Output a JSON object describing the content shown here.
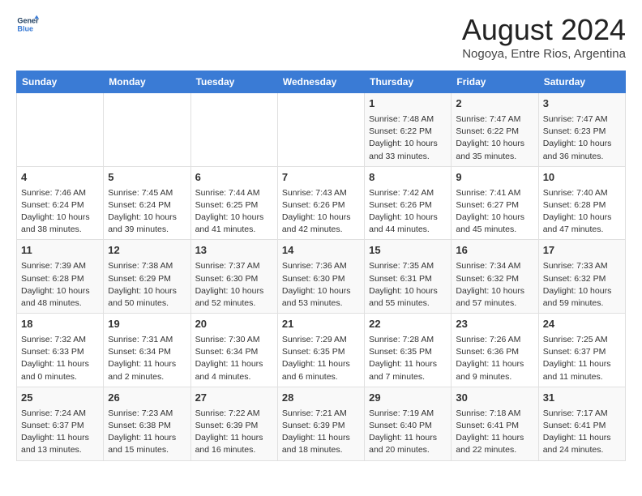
{
  "header": {
    "logo_line1": "General",
    "logo_line2": "Blue",
    "title": "August 2024",
    "subtitle": "Nogoya, Entre Rios, Argentina"
  },
  "columns": [
    "Sunday",
    "Monday",
    "Tuesday",
    "Wednesday",
    "Thursday",
    "Friday",
    "Saturday"
  ],
  "weeks": [
    [
      {
        "day": "",
        "info": ""
      },
      {
        "day": "",
        "info": ""
      },
      {
        "day": "",
        "info": ""
      },
      {
        "day": "",
        "info": ""
      },
      {
        "day": "1",
        "info": "Sunrise: 7:48 AM\nSunset: 6:22 PM\nDaylight: 10 hours\nand 33 minutes."
      },
      {
        "day": "2",
        "info": "Sunrise: 7:47 AM\nSunset: 6:22 PM\nDaylight: 10 hours\nand 35 minutes."
      },
      {
        "day": "3",
        "info": "Sunrise: 7:47 AM\nSunset: 6:23 PM\nDaylight: 10 hours\nand 36 minutes."
      }
    ],
    [
      {
        "day": "4",
        "info": "Sunrise: 7:46 AM\nSunset: 6:24 PM\nDaylight: 10 hours\nand 38 minutes."
      },
      {
        "day": "5",
        "info": "Sunrise: 7:45 AM\nSunset: 6:24 PM\nDaylight: 10 hours\nand 39 minutes."
      },
      {
        "day": "6",
        "info": "Sunrise: 7:44 AM\nSunset: 6:25 PM\nDaylight: 10 hours\nand 41 minutes."
      },
      {
        "day": "7",
        "info": "Sunrise: 7:43 AM\nSunset: 6:26 PM\nDaylight: 10 hours\nand 42 minutes."
      },
      {
        "day": "8",
        "info": "Sunrise: 7:42 AM\nSunset: 6:26 PM\nDaylight: 10 hours\nand 44 minutes."
      },
      {
        "day": "9",
        "info": "Sunrise: 7:41 AM\nSunset: 6:27 PM\nDaylight: 10 hours\nand 45 minutes."
      },
      {
        "day": "10",
        "info": "Sunrise: 7:40 AM\nSunset: 6:28 PM\nDaylight: 10 hours\nand 47 minutes."
      }
    ],
    [
      {
        "day": "11",
        "info": "Sunrise: 7:39 AM\nSunset: 6:28 PM\nDaylight: 10 hours\nand 48 minutes."
      },
      {
        "day": "12",
        "info": "Sunrise: 7:38 AM\nSunset: 6:29 PM\nDaylight: 10 hours\nand 50 minutes."
      },
      {
        "day": "13",
        "info": "Sunrise: 7:37 AM\nSunset: 6:30 PM\nDaylight: 10 hours\nand 52 minutes."
      },
      {
        "day": "14",
        "info": "Sunrise: 7:36 AM\nSunset: 6:30 PM\nDaylight: 10 hours\nand 53 minutes."
      },
      {
        "day": "15",
        "info": "Sunrise: 7:35 AM\nSunset: 6:31 PM\nDaylight: 10 hours\nand 55 minutes."
      },
      {
        "day": "16",
        "info": "Sunrise: 7:34 AM\nSunset: 6:32 PM\nDaylight: 10 hours\nand 57 minutes."
      },
      {
        "day": "17",
        "info": "Sunrise: 7:33 AM\nSunset: 6:32 PM\nDaylight: 10 hours\nand 59 minutes."
      }
    ],
    [
      {
        "day": "18",
        "info": "Sunrise: 7:32 AM\nSunset: 6:33 PM\nDaylight: 11 hours\nand 0 minutes."
      },
      {
        "day": "19",
        "info": "Sunrise: 7:31 AM\nSunset: 6:34 PM\nDaylight: 11 hours\nand 2 minutes."
      },
      {
        "day": "20",
        "info": "Sunrise: 7:30 AM\nSunset: 6:34 PM\nDaylight: 11 hours\nand 4 minutes."
      },
      {
        "day": "21",
        "info": "Sunrise: 7:29 AM\nSunset: 6:35 PM\nDaylight: 11 hours\nand 6 minutes."
      },
      {
        "day": "22",
        "info": "Sunrise: 7:28 AM\nSunset: 6:35 PM\nDaylight: 11 hours\nand 7 minutes."
      },
      {
        "day": "23",
        "info": "Sunrise: 7:26 AM\nSunset: 6:36 PM\nDaylight: 11 hours\nand 9 minutes."
      },
      {
        "day": "24",
        "info": "Sunrise: 7:25 AM\nSunset: 6:37 PM\nDaylight: 11 hours\nand 11 minutes."
      }
    ],
    [
      {
        "day": "25",
        "info": "Sunrise: 7:24 AM\nSunset: 6:37 PM\nDaylight: 11 hours\nand 13 minutes."
      },
      {
        "day": "26",
        "info": "Sunrise: 7:23 AM\nSunset: 6:38 PM\nDaylight: 11 hours\nand 15 minutes."
      },
      {
        "day": "27",
        "info": "Sunrise: 7:22 AM\nSunset: 6:39 PM\nDaylight: 11 hours\nand 16 minutes."
      },
      {
        "day": "28",
        "info": "Sunrise: 7:21 AM\nSunset: 6:39 PM\nDaylight: 11 hours\nand 18 minutes."
      },
      {
        "day": "29",
        "info": "Sunrise: 7:19 AM\nSunset: 6:40 PM\nDaylight: 11 hours\nand 20 minutes."
      },
      {
        "day": "30",
        "info": "Sunrise: 7:18 AM\nSunset: 6:41 PM\nDaylight: 11 hours\nand 22 minutes."
      },
      {
        "day": "31",
        "info": "Sunrise: 7:17 AM\nSunset: 6:41 PM\nDaylight: 11 hours\nand 24 minutes."
      }
    ]
  ]
}
